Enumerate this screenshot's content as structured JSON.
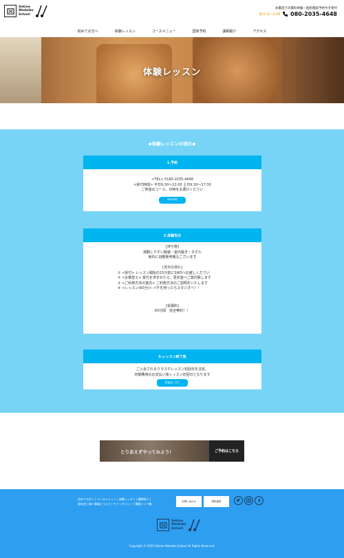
{
  "header": {
    "logo_text": [
      "Sekine",
      "Wadaiko",
      "School"
    ],
    "contact_line1": "お電話での無料体験・個別相談予約今ぞ受付",
    "contact_hours": "受付 10～21時",
    "contact_phone": "080-2035-4648"
  },
  "nav": {
    "items": [
      "初めての方へ",
      "体験レッスン",
      "コースメニュー",
      "団体予約",
      "講師紹介",
      "アクセス"
    ]
  },
  "hero": {
    "title": "体験レッスン"
  },
  "flow": {
    "title": "◆体験レッスンの流れ◆",
    "step1": {
      "heading": "1.予約",
      "lines": [
        "<TEL> 0180-2035-4648",
        "<受付時間> 平日9:30～22:00 土日9:30～17:30",
        "ご希望のコース、日時をお選びください"
      ],
      "button": "WEB予約"
    },
    "step2": {
      "heading": "2.体験当日",
      "lines": [
        "[持ち物]",
        "運動しやすい服装・室内履き・タオル",
        "館内に自動販売機もございます",
        "",
        "[当日の流れ]"
      ],
      "steps": [
        "① <受付> レッスン開始の15分前にSWSへお越しください",
        "② <お着替え> 受付を済ませたら、更衣室へご案内致します",
        "③ <ご利用方法の案内> ご利用方法のご説明をいたします",
        "④ <レッスン(60分)> バチを持ったらスタジオへ！！"
      ],
      "fee_label": "[受講料]",
      "fee_value": "60分間　完全無料！！"
    },
    "step3": {
      "heading": "3.レッスン終了後",
      "lines": [
        "ご入会されるクラスやレッスン初回日を決定。",
        "初期費用のお支払い後レッスン初回日となります"
      ],
      "button": "料金はこちら"
    }
  },
  "banner": {
    "text": "とりあえずやってみよう！",
    "book_label": "ご予約はこちら"
  },
  "footer": {
    "links": [
      "初めての方へ",
      "コースメニュー",
      "体験レッスン",
      "講師紹介",
      "個本会",
      "個人情報について",
      "サイトポリシー",
      "関連リンク集"
    ],
    "contact_button": "お問い合わせ",
    "lesson_button": "資料請求",
    "logo_text": [
      "Sekine",
      "Wadaiko",
      "School"
    ],
    "copyright": "Copyright © 2020 Sekine Wadaiko School All Rights Reserved."
  },
  "colors": {
    "accent_blue": "#00b4f0",
    "section_blue": "#78d4f7",
    "footer_blue": "#2d9ef0",
    "hours_orange": "#f0a000"
  },
  "icons": [
    "drum-logo-icon",
    "phone-icon",
    "twitter-icon",
    "instagram-icon",
    "facebook-icon"
  ]
}
